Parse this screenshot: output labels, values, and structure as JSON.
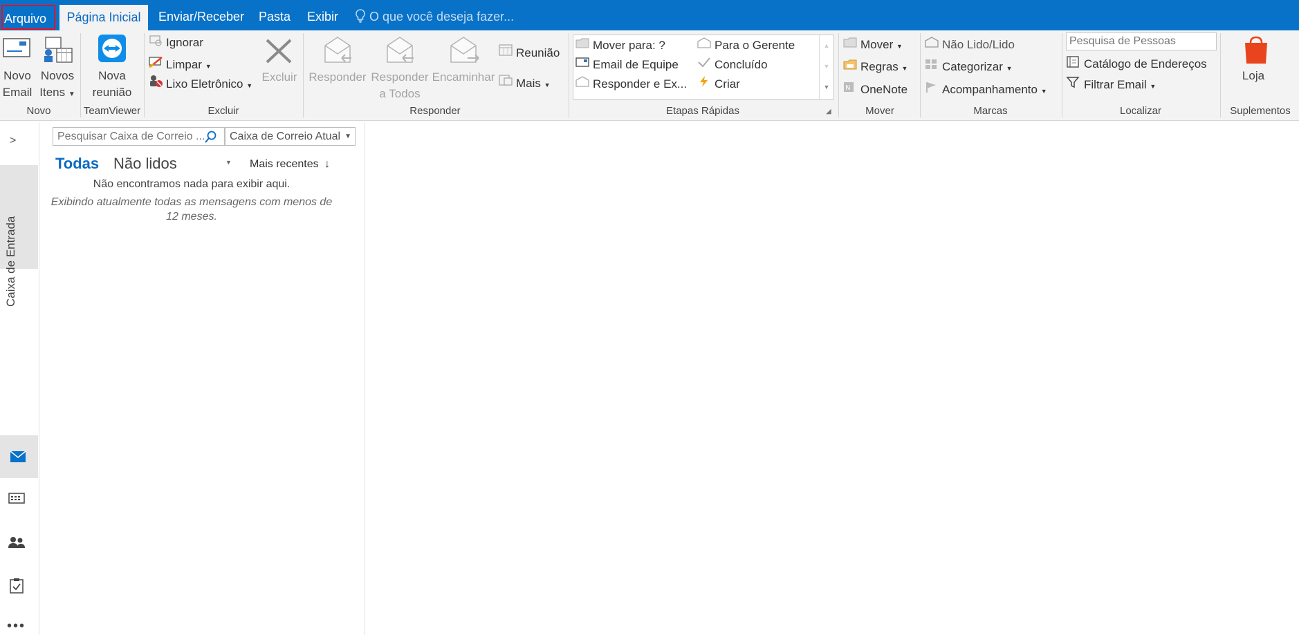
{
  "tabs": {
    "file": "Arquivo",
    "home": "Página Inicial",
    "send_receive": "Enviar/Receber",
    "folder": "Pasta",
    "view": "Exibir",
    "tell_me": "O que você deseja fazer..."
  },
  "ribbon": {
    "novo": {
      "new_email_l1": "Novo",
      "new_email_l2": "Email",
      "new_items_l1": "Novos",
      "new_items_l2": "Itens",
      "group": "Novo"
    },
    "teamviewer": {
      "meeting_l1": "Nova",
      "meeting_l2": "reunião",
      "group": "TeamViewer"
    },
    "excluir": {
      "ignore": "Ignorar",
      "clean": "Limpar",
      "junk": "Lixo Eletrônico",
      "delete": "Excluir",
      "group": "Excluir"
    },
    "responder": {
      "reply": "Responder",
      "reply_all_l1": "Responder",
      "reply_all_l2": "a Todos",
      "forward": "Encaminhar",
      "meeting": "Reunião",
      "more": "Mais",
      "group": "Responder"
    },
    "quick_steps": {
      "move_to": "Mover para: ?",
      "team_email": "Email de Equipe",
      "reply_delete": "Responder e Ex...",
      "to_manager": "Para o Gerente",
      "done": "Concluído",
      "create": "Criar",
      "group": "Etapas Rápidas"
    },
    "mover": {
      "move": "Mover",
      "rules": "Regras",
      "onenote": "OneNote",
      "group": "Mover"
    },
    "marcas": {
      "unread_read": "Não Lido/Lido",
      "categorize": "Categorizar",
      "followup": "Acompanhamento",
      "group": "Marcas"
    },
    "localizar": {
      "search_people_placeholder": "Pesquisa de Pessoas",
      "address_book": "Catálogo de Endereços",
      "filter_email": "Filtrar Email",
      "group": "Localizar"
    },
    "suplementos": {
      "store": "Loja",
      "group": "Suplementos"
    }
  },
  "rail": {
    "inbox_label": "Caixa de Entrada"
  },
  "mail_list": {
    "search_placeholder": "Pesquisar Caixa de Correio ...",
    "scope": "Caixa de Correio Atual",
    "filter_all": "Todas",
    "filter_unread": "Não lidos",
    "sort": "Mais recentes",
    "empty_msg": "Não encontramos nada para exibir aqui.",
    "empty_sub": "Exibindo atualmente todas as mensagens com menos de 12 meses."
  },
  "colors": {
    "brand_blue": "#0872c8",
    "ribbon_bg": "#f3f3f3",
    "active_tab_text": "#0b6ac4",
    "store_orange": "#e8451e"
  }
}
